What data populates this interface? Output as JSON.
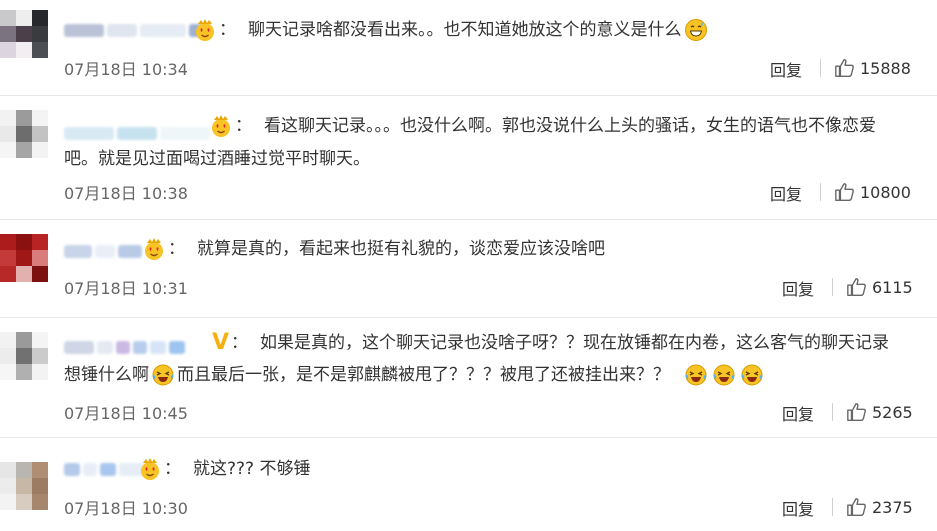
{
  "comments": [
    {
      "text": "聊天记录啥都没看出来。。也不知道她放这个的意义是什么",
      "date": "07月18日 10:34",
      "reply": "回复",
      "likes": "15888"
    },
    {
      "text_line1": "看这聊天记录。。。也没什么啊。郭也没说什么上头的骚话，女生的语气也不像恋爱",
      "text_line2": "吧。就是见过面喝过酒睡过觉平时聊天。",
      "date": "07月18日 10:38",
      "reply": "回复",
      "likes": "10800"
    },
    {
      "text": "就算是真的，看起来也挺有礼貌的，谈恋爱应该没啥吧",
      "date": "07月18日 10:31",
      "reply": "回复",
      "likes": "6115"
    },
    {
      "text_line1": "如果是真的，这个聊天记录也没啥子呀？？现在放锤都在内卷，这么客气的聊天记录",
      "text_line2a": "想锤什么啊",
      "text_line2b": "而且最后一张，是不是郭麒麟被甩了？？？被甩了还被挂出来？？",
      "date": "07月18日 10:45",
      "reply": "回复",
      "likes": "5265"
    },
    {
      "text": "就这??? 不够锤",
      "date": "07月18日 10:30",
      "reply": "回复",
      "likes": "2375"
    }
  ],
  "colon": "：",
  "verified_badge": "V",
  "icons": {
    "crown": "crown-heart-eyes-emoji-icon",
    "sweat": "grinning-sweat-emoji-icon",
    "laugh": "laughing-tears-emoji-icon",
    "like": "thumbs-up-icon"
  }
}
